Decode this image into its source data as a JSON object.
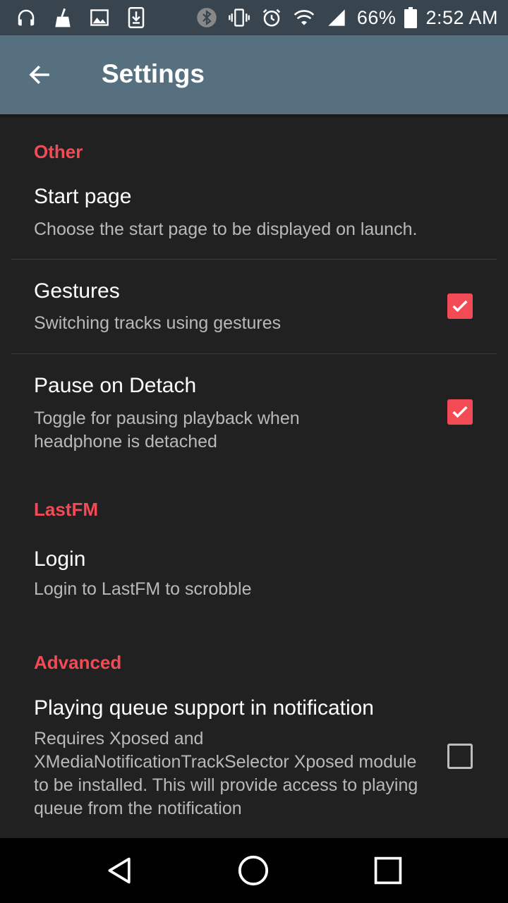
{
  "status_bar": {
    "battery_text": "66%",
    "time": "2:52 AM",
    "left_icons": [
      "headphones-icon",
      "broom-icon",
      "image-icon",
      "download-icon"
    ],
    "right_icons": [
      "bluetooth-icon",
      "vibrate-icon",
      "alarm-icon",
      "wifi-icon",
      "signal-icon",
      "battery-icon"
    ]
  },
  "toolbar": {
    "title": "Settings",
    "back_icon": "arrow-left-icon"
  },
  "colors": {
    "accent": "#f24b55",
    "toolbar": "#56707f",
    "statusbar": "#38454f",
    "background": "#212121"
  },
  "sections": [
    {
      "header": "Other",
      "items": [
        {
          "title": "Start page",
          "summary": "Choose the start page to be displayed on launch."
        },
        {
          "title": "Gestures",
          "summary": "Switching tracks using gestures",
          "checked": true
        },
        {
          "title": "Pause on Detach",
          "summary": "Toggle for pausing playback when headphone is detached",
          "checked": true
        }
      ]
    },
    {
      "header": "LastFM",
      "items": [
        {
          "title": "Login",
          "summary": "Login to LastFM to scrobble"
        }
      ]
    },
    {
      "header": "Advanced",
      "items": [
        {
          "title": "Playing queue support in notification",
          "summary": "Requires Xposed and XMediaNotificationTrackSelector Xposed module to be installed. This will provide access to playing queue from the notification",
          "checked": false
        }
      ]
    }
  ],
  "nav_bar": {
    "buttons": [
      "back-triangle-icon",
      "home-circle-icon",
      "recents-square-icon"
    ]
  }
}
